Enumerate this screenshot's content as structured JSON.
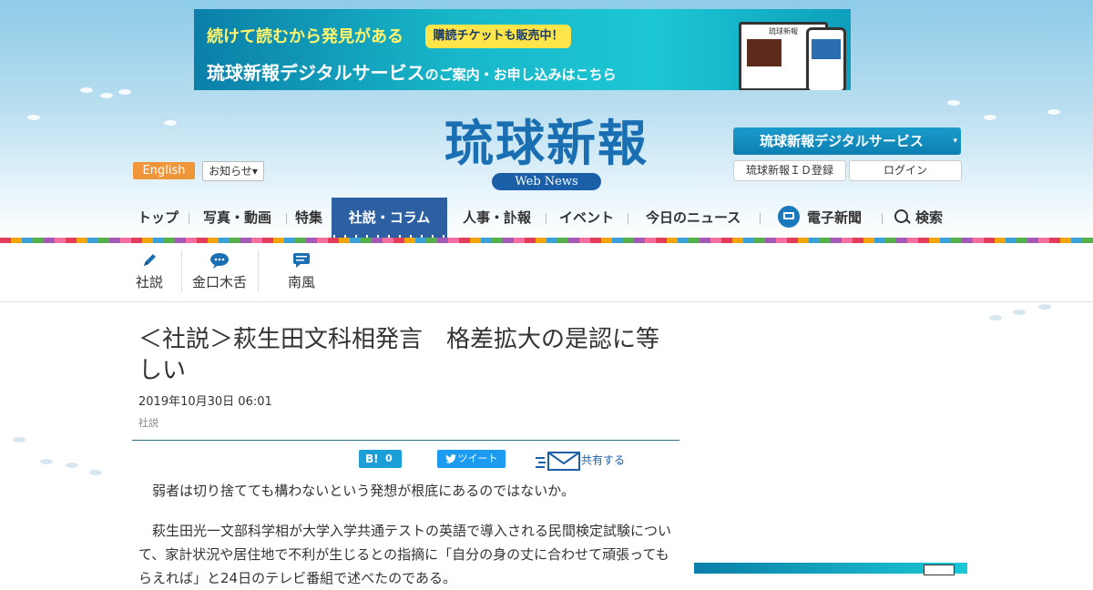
{
  "banner": {
    "line1": "続けて読むから発見がある",
    "pill": "購読チケットも販売中！",
    "line2a": "琉球新報デジタルサービス",
    "line2b": "のご案内・お申し込み",
    "line2c": "はこちら",
    "laptop_logo": "琉球新報"
  },
  "header": {
    "english": "English",
    "notice": "お知らせ▾",
    "logo": "琉球新報",
    "logo_sub": "Web News",
    "digital_service": "琉球新報デジタルサービス",
    "caret": "▾",
    "register": "琉球新報ＩＤ登録",
    "login": "ログイン"
  },
  "nav": {
    "items": [
      "トップ",
      "写真・動画",
      "特集",
      "社説・コラム",
      "人事・訃報",
      "イベント",
      "今日のニュース",
      "電子新聞",
      "検索"
    ]
  },
  "subnav": {
    "items": [
      "社説",
      "金口木舌",
      "南風"
    ]
  },
  "article": {
    "title": "＜社説＞萩生田文科相発言　格差拡大の是認に等しい",
    "date": "2019年10月30日 06:01",
    "category": "社説",
    "hatena_label": "B!",
    "hatena_count": "0",
    "tweet": "ツイート",
    "share": "共有する",
    "p1": "　弱者は切り捨てても構わないという発想が根底にあるのではないか。",
    "p2": "　萩生田光一文部科学相が大学入学共通テストの英語で導入される民間検定試験について、家計状況や居住地で不利が生じるとの指摘に「自分の身の丈に合わせて頑張ってもらえれば」と24日のテレビ番組で述べたのである。"
  },
  "colors": {
    "nav_active": "#2d5fa3",
    "logo": "#1a6fb3",
    "english_button": "#f0963a",
    "digital_button": "#1a9ccc"
  }
}
